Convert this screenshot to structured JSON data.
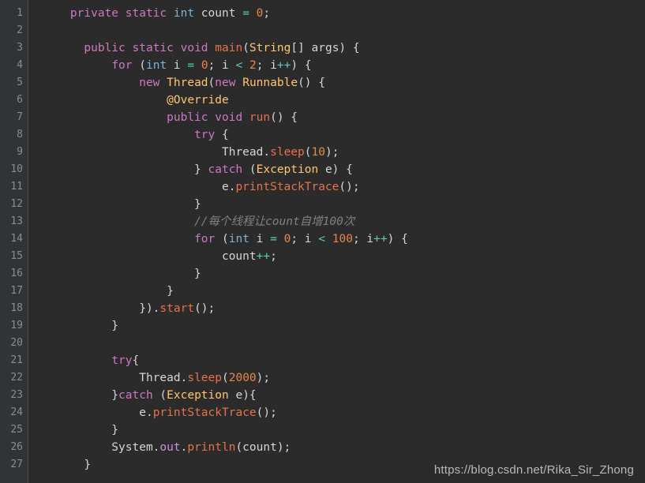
{
  "editor": {
    "language": "Java",
    "theme": "darcula",
    "background_color": "#2b2b2b",
    "gutter_color": "#313335",
    "line_count": 27,
    "line_numbers": [
      1,
      2,
      3,
      4,
      5,
      6,
      7,
      8,
      9,
      10,
      11,
      12,
      13,
      14,
      15,
      16,
      17,
      18,
      19,
      20,
      21,
      22,
      23,
      24,
      25,
      26,
      27
    ],
    "colors": {
      "keyword": "#cc78c3",
      "type": "#7fb3d5",
      "class_name": "#ffc66d",
      "method": "#e8714a",
      "number": "#e8864a",
      "operator": "#5fc9bf",
      "field": "#c792d8",
      "comment": "#808080",
      "plain": "#d6d6d6",
      "line_number": "#888f8f"
    },
    "plain_text": [
      "    private static int count = 0;",
      "",
      "    public static void main(String[] args) {",
      "        for (int i = 0; i < 2; i++) {",
      "            new Thread(new Runnable() {",
      "                @Override",
      "                public void run() {",
      "                    try {",
      "                        Thread.sleep(10);",
      "                    } catch (Exception e) {",
      "                        e.printStackTrace();",
      "                    }",
      "                    //每个线程让count自增100次",
      "                    for (int i = 0; i < 100; i++) {",
      "                        count++;",
      "                    }",
      "                }",
      "            }).start();",
      "        }",
      "",
      "        try{",
      "            Thread.sleep(2000);",
      "        }catch (Exception e){",
      "            e.printStackTrace();",
      "        }",
      "        System.out.println(count);",
      "    }"
    ],
    "lines": [
      {
        "n": 1,
        "tokens": [
          {
            "t": "    ",
            "c": "pln"
          },
          {
            "t": "private static",
            "c": "kw"
          },
          {
            "t": " ",
            "c": "pln"
          },
          {
            "t": "int",
            "c": "typ"
          },
          {
            "t": " count ",
            "c": "pln"
          },
          {
            "t": "=",
            "c": "op"
          },
          {
            "t": " ",
            "c": "pln"
          },
          {
            "t": "0",
            "c": "num"
          },
          {
            "t": ";",
            "c": "pln"
          }
        ]
      },
      {
        "n": 2,
        "tokens": []
      },
      {
        "n": 3,
        "tokens": [
          {
            "t": "      ",
            "c": "pln"
          },
          {
            "t": "public static void",
            "c": "kw"
          },
          {
            "t": " ",
            "c": "pln"
          },
          {
            "t": "main",
            "c": "mth"
          },
          {
            "t": "(",
            "c": "pln"
          },
          {
            "t": "String",
            "c": "cls"
          },
          {
            "t": "[] args) {",
            "c": "pln"
          }
        ]
      },
      {
        "n": 4,
        "tokens": [
          {
            "t": "          ",
            "c": "pln"
          },
          {
            "t": "for",
            "c": "kw"
          },
          {
            "t": " (",
            "c": "pln"
          },
          {
            "t": "int",
            "c": "typ"
          },
          {
            "t": " i ",
            "c": "pln"
          },
          {
            "t": "=",
            "c": "op"
          },
          {
            "t": " ",
            "c": "pln"
          },
          {
            "t": "0",
            "c": "num"
          },
          {
            "t": "; i ",
            "c": "pln"
          },
          {
            "t": "<",
            "c": "op"
          },
          {
            "t": " ",
            "c": "pln"
          },
          {
            "t": "2",
            "c": "num"
          },
          {
            "t": "; i",
            "c": "pln"
          },
          {
            "t": "++",
            "c": "op"
          },
          {
            "t": ") {",
            "c": "pln"
          }
        ]
      },
      {
        "n": 5,
        "tokens": [
          {
            "t": "              ",
            "c": "pln"
          },
          {
            "t": "new",
            "c": "kw"
          },
          {
            "t": " ",
            "c": "pln"
          },
          {
            "t": "Thread",
            "c": "cls"
          },
          {
            "t": "(",
            "c": "pln"
          },
          {
            "t": "new",
            "c": "kw"
          },
          {
            "t": " ",
            "c": "pln"
          },
          {
            "t": "Runnable",
            "c": "cls"
          },
          {
            "t": "() {",
            "c": "pln"
          }
        ]
      },
      {
        "n": 6,
        "tokens": [
          {
            "t": "                  ",
            "c": "pln"
          },
          {
            "t": "@Override",
            "c": "cls"
          }
        ]
      },
      {
        "n": 7,
        "tokens": [
          {
            "t": "                  ",
            "c": "pln"
          },
          {
            "t": "public void",
            "c": "kw"
          },
          {
            "t": " ",
            "c": "pln"
          },
          {
            "t": "run",
            "c": "mth"
          },
          {
            "t": "() {",
            "c": "pln"
          }
        ]
      },
      {
        "n": 8,
        "tokens": [
          {
            "t": "                      ",
            "c": "pln"
          },
          {
            "t": "try",
            "c": "kw"
          },
          {
            "t": " {",
            "c": "pln"
          }
        ]
      },
      {
        "n": 9,
        "tokens": [
          {
            "t": "                          ",
            "c": "pln"
          },
          {
            "t": "Thread",
            "c": "pln"
          },
          {
            "t": ".",
            "c": "pln"
          },
          {
            "t": "sleep",
            "c": "mth"
          },
          {
            "t": "(",
            "c": "pln"
          },
          {
            "t": "10",
            "c": "num"
          },
          {
            "t": ");",
            "c": "pln"
          }
        ]
      },
      {
        "n": 10,
        "tokens": [
          {
            "t": "                      } ",
            "c": "pln"
          },
          {
            "t": "catch",
            "c": "kw"
          },
          {
            "t": " (",
            "c": "pln"
          },
          {
            "t": "Exception",
            "c": "cls"
          },
          {
            "t": " e) {",
            "c": "pln"
          }
        ]
      },
      {
        "n": 11,
        "tokens": [
          {
            "t": "                          e.",
            "c": "pln"
          },
          {
            "t": "printStackTrace",
            "c": "mth"
          },
          {
            "t": "();",
            "c": "pln"
          }
        ]
      },
      {
        "n": 12,
        "tokens": [
          {
            "t": "                      }",
            "c": "pln"
          }
        ]
      },
      {
        "n": 13,
        "tokens": [
          {
            "t": "                      ",
            "c": "pln"
          },
          {
            "t": "//每个线程让count自增100次",
            "c": "cmt"
          }
        ]
      },
      {
        "n": 14,
        "tokens": [
          {
            "t": "                      ",
            "c": "pln"
          },
          {
            "t": "for",
            "c": "kw"
          },
          {
            "t": " (",
            "c": "pln"
          },
          {
            "t": "int",
            "c": "typ"
          },
          {
            "t": " i ",
            "c": "pln"
          },
          {
            "t": "=",
            "c": "op"
          },
          {
            "t": " ",
            "c": "pln"
          },
          {
            "t": "0",
            "c": "num"
          },
          {
            "t": "; i ",
            "c": "pln"
          },
          {
            "t": "<",
            "c": "op"
          },
          {
            "t": " ",
            "c": "pln"
          },
          {
            "t": "100",
            "c": "num"
          },
          {
            "t": "; i",
            "c": "pln"
          },
          {
            "t": "++",
            "c": "op"
          },
          {
            "t": ") {",
            "c": "pln"
          }
        ]
      },
      {
        "n": 15,
        "tokens": [
          {
            "t": "                          count",
            "c": "pln"
          },
          {
            "t": "++",
            "c": "op"
          },
          {
            "t": ";",
            "c": "pln"
          }
        ]
      },
      {
        "n": 16,
        "tokens": [
          {
            "t": "                      }",
            "c": "pln"
          }
        ]
      },
      {
        "n": 17,
        "tokens": [
          {
            "t": "                  }",
            "c": "pln"
          }
        ]
      },
      {
        "n": 18,
        "tokens": [
          {
            "t": "              }).",
            "c": "pln"
          },
          {
            "t": "start",
            "c": "mth"
          },
          {
            "t": "();",
            "c": "pln"
          }
        ]
      },
      {
        "n": 19,
        "tokens": [
          {
            "t": "          }",
            "c": "pln"
          }
        ]
      },
      {
        "n": 20,
        "tokens": []
      },
      {
        "n": 21,
        "tokens": [
          {
            "t": "          ",
            "c": "pln"
          },
          {
            "t": "try",
            "c": "kw"
          },
          {
            "t": "{",
            "c": "pln"
          }
        ]
      },
      {
        "n": 22,
        "tokens": [
          {
            "t": "              ",
            "c": "pln"
          },
          {
            "t": "Thread",
            "c": "pln"
          },
          {
            "t": ".",
            "c": "pln"
          },
          {
            "t": "sleep",
            "c": "mth"
          },
          {
            "t": "(",
            "c": "pln"
          },
          {
            "t": "2000",
            "c": "num"
          },
          {
            "t": ");",
            "c": "pln"
          }
        ]
      },
      {
        "n": 23,
        "tokens": [
          {
            "t": "          }",
            "c": "pln"
          },
          {
            "t": "catch",
            "c": "kw"
          },
          {
            "t": " (",
            "c": "pln"
          },
          {
            "t": "Exception",
            "c": "cls"
          },
          {
            "t": " e){",
            "c": "pln"
          }
        ]
      },
      {
        "n": 24,
        "tokens": [
          {
            "t": "              e.",
            "c": "pln"
          },
          {
            "t": "printStackTrace",
            "c": "mth"
          },
          {
            "t": "();",
            "c": "pln"
          }
        ]
      },
      {
        "n": 25,
        "tokens": [
          {
            "t": "          }",
            "c": "pln"
          }
        ]
      },
      {
        "n": 26,
        "tokens": [
          {
            "t": "          System.",
            "c": "pln"
          },
          {
            "t": "out",
            "c": "fld"
          },
          {
            "t": ".",
            "c": "pln"
          },
          {
            "t": "println",
            "c": "mth"
          },
          {
            "t": "(count);",
            "c": "pln"
          }
        ]
      },
      {
        "n": 27,
        "tokens": [
          {
            "t": "      }",
            "c": "pln"
          }
        ]
      }
    ]
  },
  "watermark": {
    "text": "https://blog.csdn.net/Rika_Sir_Zhong"
  }
}
